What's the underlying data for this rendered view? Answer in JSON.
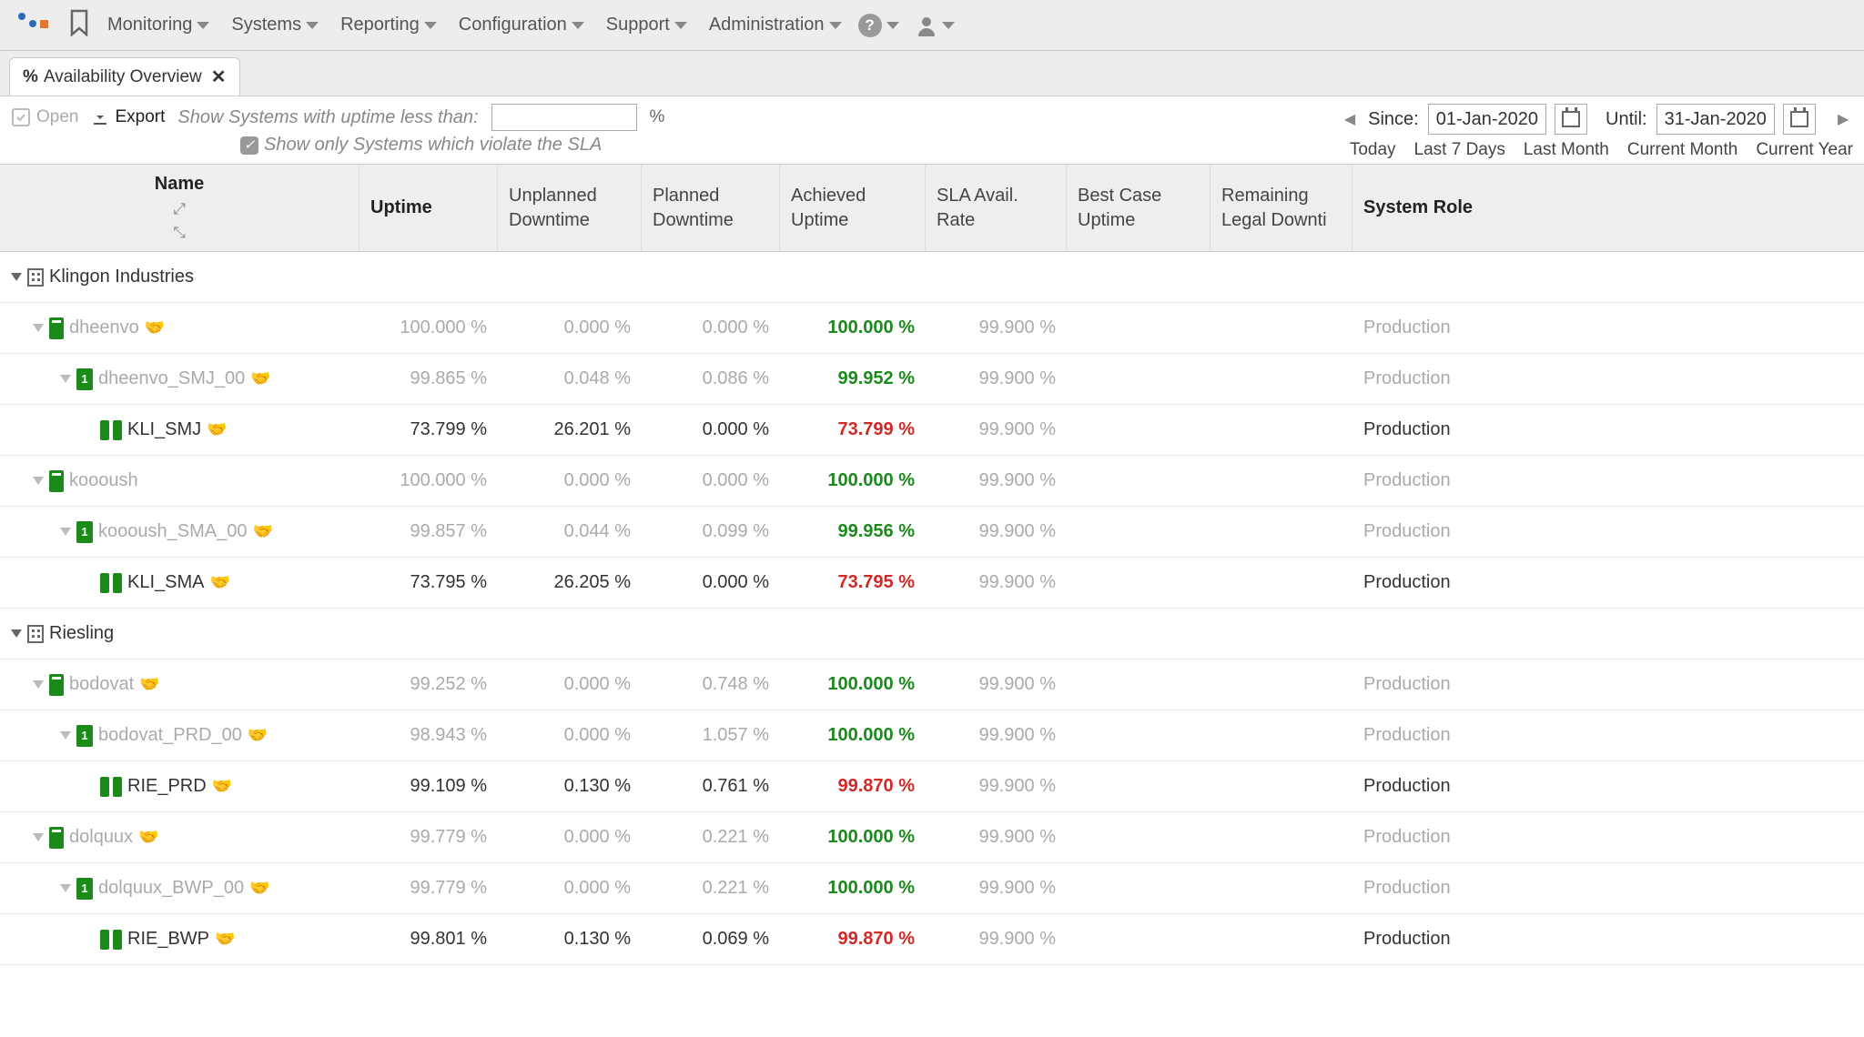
{
  "nav": {
    "items": [
      "Monitoring",
      "Systems",
      "Reporting",
      "Configuration",
      "Support",
      "Administration"
    ]
  },
  "tab": {
    "title": "Availability Overview"
  },
  "toolbar": {
    "open": "Open",
    "export": "Export",
    "filter_label": "Show Systems with uptime less than:",
    "pct": "%",
    "sla_checkbox_label": "Show only Systems which violate the SLA",
    "since_label": "Since:",
    "until_label": "Until:",
    "since_value": "01-Jan-2020",
    "until_value": "31-Jan-2020",
    "quick": [
      "Today",
      "Last 7 Days",
      "Last Month",
      "Current Month",
      "Current Year"
    ]
  },
  "columns": {
    "name": "Name",
    "uptime": "Uptime",
    "unplanned1": "Unplanned",
    "unplanned2": "Downtime",
    "planned1": "Planned",
    "planned2": "Downtime",
    "achieved1": "Achieved",
    "achieved2": "Uptime",
    "sla1": "SLA Avail.",
    "sla2": "Rate",
    "best1": "Best Case",
    "best2": "Uptime",
    "remain1": "Remaining",
    "remain2": "Legal Downti",
    "role": "System Role"
  },
  "rows": [
    {
      "type": "org",
      "indent": 0,
      "name": "Klingon Industries"
    },
    {
      "type": "host",
      "indent": 1,
      "dim": true,
      "name": "dheenvo",
      "handshake": true,
      "uptime": "100.000 %",
      "unp": "0.000 %",
      "plan": "0.000 %",
      "ach": "100.000 %",
      "achClass": "green",
      "sla": "99.900 %",
      "role": "Production",
      "roleDim": true
    },
    {
      "type": "inst",
      "indent": 2,
      "dim": true,
      "name": "dheenvo_SMJ_00",
      "handshake": true,
      "uptime": "99.865 %",
      "unp": "0.048 %",
      "plan": "0.086 %",
      "ach": "99.952 %",
      "achClass": "green",
      "sla": "99.900 %",
      "role": "Production",
      "roleDim": true
    },
    {
      "type": "db",
      "indent": 3,
      "dim": false,
      "name": "KLI_SMJ",
      "handshake": true,
      "uptime": "73.799 %",
      "unp": "26.201 %",
      "plan": "0.000 %",
      "ach": "73.799 %",
      "achClass": "red",
      "sla": "99.900 %",
      "role": "Production",
      "roleDim": false
    },
    {
      "type": "host",
      "indent": 1,
      "dim": true,
      "name": "koooush",
      "uptime": "100.000 %",
      "unp": "0.000 %",
      "plan": "0.000 %",
      "ach": "100.000 %",
      "achClass": "green",
      "sla": "99.900 %",
      "role": "Production",
      "roleDim": true
    },
    {
      "type": "inst",
      "indent": 2,
      "dim": true,
      "name": "koooush_SMA_00",
      "handshake": true,
      "uptime": "99.857 %",
      "unp": "0.044 %",
      "plan": "0.099 %",
      "ach": "99.956 %",
      "achClass": "green",
      "sla": "99.900 %",
      "role": "Production",
      "roleDim": true
    },
    {
      "type": "db",
      "indent": 3,
      "dim": false,
      "name": "KLI_SMA",
      "handshake": true,
      "uptime": "73.795 %",
      "unp": "26.205 %",
      "plan": "0.000 %",
      "ach": "73.795 %",
      "achClass": "red",
      "sla": "99.900 %",
      "role": "Production",
      "roleDim": false
    },
    {
      "type": "org",
      "indent": 0,
      "name": "Riesling"
    },
    {
      "type": "host",
      "indent": 1,
      "dim": true,
      "name": "bodovat",
      "handshake": true,
      "uptime": "99.252 %",
      "unp": "0.000 %",
      "plan": "0.748 %",
      "ach": "100.000 %",
      "achClass": "green",
      "sla": "99.900 %",
      "role": "Production",
      "roleDim": true
    },
    {
      "type": "inst",
      "indent": 2,
      "dim": true,
      "name": "bodovat_PRD_00",
      "handshake": true,
      "uptime": "98.943 %",
      "unp": "0.000 %",
      "plan": "1.057 %",
      "ach": "100.000 %",
      "achClass": "green",
      "sla": "99.900 %",
      "role": "Production",
      "roleDim": true
    },
    {
      "type": "db",
      "indent": 3,
      "dim": false,
      "name": "RIE_PRD",
      "handshake": true,
      "uptime": "99.109 %",
      "unp": "0.130 %",
      "plan": "0.761 %",
      "ach": "99.870 %",
      "achClass": "red",
      "sla": "99.900 %",
      "role": "Production",
      "roleDim": false
    },
    {
      "type": "host",
      "indent": 1,
      "dim": true,
      "name": "dolquux",
      "handshake": true,
      "uptime": "99.779 %",
      "unp": "0.000 %",
      "plan": "0.221 %",
      "ach": "100.000 %",
      "achClass": "green",
      "sla": "99.900 %",
      "role": "Production",
      "roleDim": true
    },
    {
      "type": "inst",
      "indent": 2,
      "dim": true,
      "name": "dolquux_BWP_00",
      "handshake": true,
      "uptime": "99.779 %",
      "unp": "0.000 %",
      "plan": "0.221 %",
      "ach": "100.000 %",
      "achClass": "green",
      "sla": "99.900 %",
      "role": "Production",
      "roleDim": true
    },
    {
      "type": "db",
      "indent": 3,
      "dim": false,
      "name": "RIE_BWP",
      "handshake": true,
      "uptime": "99.801 %",
      "unp": "0.130 %",
      "plan": "0.069 %",
      "ach": "99.870 %",
      "achClass": "red",
      "sla": "99.900 %",
      "role": "Production",
      "roleDim": false
    }
  ]
}
